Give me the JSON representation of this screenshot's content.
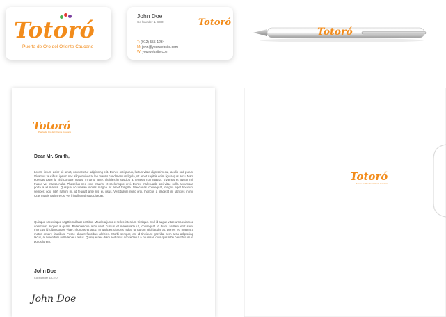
{
  "logo": {
    "word": "Totoró",
    "tagline": "Puerta de Oro del Oriente Caucano"
  },
  "contact": {
    "name": "John Doe",
    "title": "Co-founder & CEO",
    "phone_label": "T:",
    "phone": "(912) 555-1234",
    "email_label": "M:",
    "email": "john@yourwebsite.com",
    "web_label": "W:",
    "web": "yourwebsite.com"
  },
  "letter": {
    "greeting": "Dear Mr. Smith,",
    "para1": "Lorem ipsum dolor sit amet, consectetur adipiscing elit. Donec orci purus, luctus vitae dignissim eu, iaculis sed purus. Vivamus faucibus, ipsum nec aliquet viverra, leo mauris condimentum ligula, sit amet sagittis enim ligula quis arcu. Nam egestas tortor id nisi porttitor mattis. In tortor ante, ultricies in suscipit a, tempus non massa. Vivamus et auctor mi. Fusce vel massa nulla. Phasellus nec eros mauris, et scelerisque orci. Donec malesuada orci vitae nulla accumsan porta a id massa. Quisque accumsan iaculis magna sit amet fringilla. Maecenas consequat, magna eget tincidunt semper, odio nibh rutrum mi, id feugiat ante nisi eu risus. Vestibulum nunc orci, rhoncus a placerat in, ultricies in mi. Cras mattis varius eros, vel fringilla nisi suscipit eget.",
    "para2": "Quisque scelerisque sagittis nulla at porttitor. Mauris a justo et tellus interdum tristique. Sed id augue vitae urna euismod commodo aliquet a quam. Pellentesque arcu velit, cursus et malesuada ut, consequat id diam. Nullam erat sem, rhoncus id ullamcorper vitae, rhoncus et arcu. In ultricies ultricies nulla, ut rutrum nisi iaculis at. Donec eu magna a metus ornare faucibus. Fusce aliquet faucibus ultricies. Morbi semper, est id tincidunt gravida, sem arcu adipiscing lacus, at bibendum nulla leo eu purus. Quisque nec diam sed risus consectetur a ccumsan quis quis nibh. Vestibulum id purus lorem.",
    "sign_name": "John Doe",
    "sign_title": "Co-founder & CEO",
    "signature": "John Doe"
  },
  "colors": {
    "brand": "#f28c1c",
    "green": "#4caf50",
    "red": "#e53935",
    "purple": "#7b3fa0"
  }
}
